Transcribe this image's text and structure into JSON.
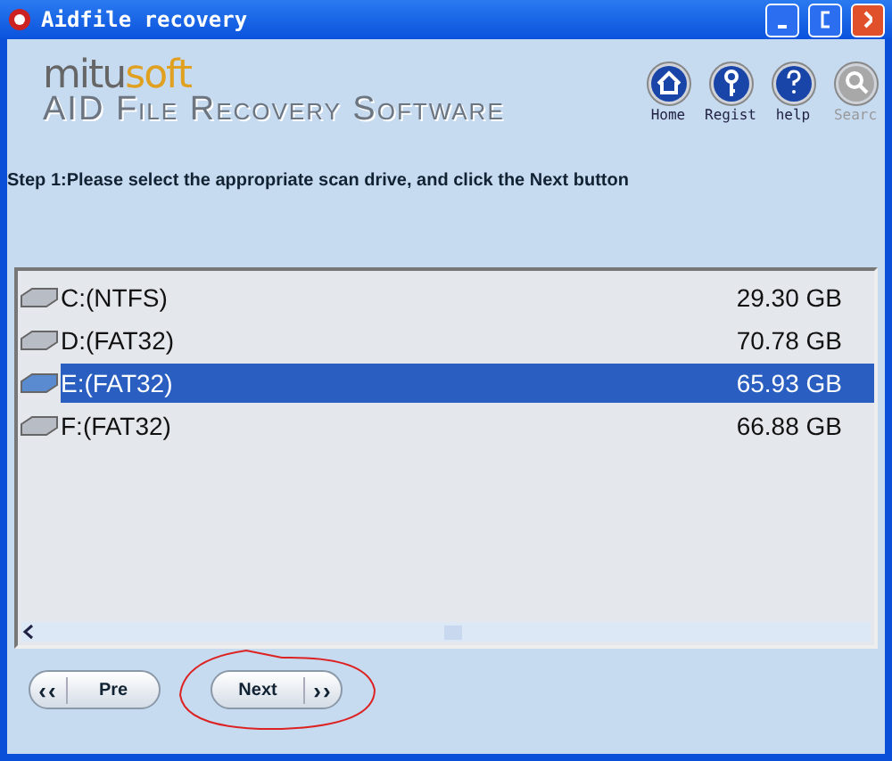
{
  "window": {
    "title": "Aidfile recovery"
  },
  "logo": {
    "brand_start": "mitu",
    "brand_end": "soft",
    "subtitle": "AID File Recovery Software"
  },
  "toolbar": [
    {
      "kind": "home",
      "label": "Home",
      "disabled": false
    },
    {
      "kind": "key",
      "label": "Regist",
      "disabled": false
    },
    {
      "kind": "help",
      "label": "help",
      "disabled": false
    },
    {
      "kind": "search",
      "label": "Searc",
      "disabled": true
    }
  ],
  "instruction": "Step 1:Please select the appropriate scan drive, and click the Next button",
  "drives": [
    {
      "name": "C:(NTFS)",
      "size": "29.30 GB",
      "selected": false
    },
    {
      "name": "D:(FAT32)",
      "size": "70.78 GB",
      "selected": false
    },
    {
      "name": "E:(FAT32)",
      "size": "65.93 GB",
      "selected": true
    },
    {
      "name": "F:(FAT32)",
      "size": "66.88 GB",
      "selected": false
    }
  ],
  "buttons": [
    {
      "kind": "back",
      "label": "Pre",
      "arrow": "‹‹"
    },
    {
      "kind": "next",
      "label": "Next",
      "arrow": "››"
    }
  ]
}
